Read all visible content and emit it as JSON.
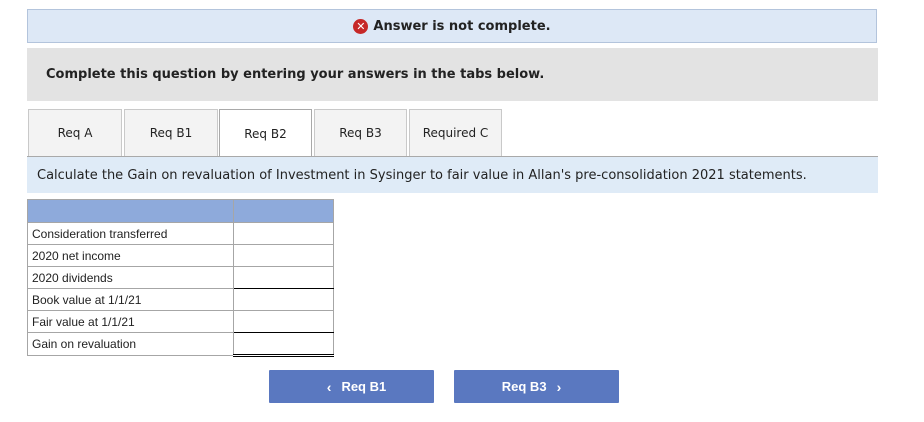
{
  "banner": {
    "text": "Answer is not complete.",
    "icon": "error-x-icon",
    "icon_glyph": "✕"
  },
  "instructions": "Complete this question by entering your answers in the tabs below.",
  "tabs": [
    {
      "label": "Req A"
    },
    {
      "label": "Req B1"
    },
    {
      "label": "Req B2",
      "active": true
    },
    {
      "label": "Req B3"
    },
    {
      "label": "Required C"
    }
  ],
  "question": "Calculate the Gain on revaluation of Investment in Sysinger to fair value in Allan's pre-consolidation 2021 statements.",
  "table": {
    "rows": [
      {
        "label": "Consideration transferred",
        "value": ""
      },
      {
        "label": "2020 net income",
        "value": ""
      },
      {
        "label": "2020 dividends",
        "value": ""
      },
      {
        "label": "Book value at 1/1/21",
        "value": ""
      },
      {
        "label": "Fair value at 1/1/21",
        "value": ""
      },
      {
        "label": "Gain on revaluation",
        "value": ""
      }
    ]
  },
  "nav": {
    "prev_label": "Req B1",
    "next_label": "Req B3",
    "prev_glyph": "‹",
    "next_glyph": "›"
  },
  "colors": {
    "banner_bg": "#dde8f6",
    "header_blue": "#8eaadb",
    "button_blue": "#5a78c0",
    "error_red": "#c62828"
  }
}
